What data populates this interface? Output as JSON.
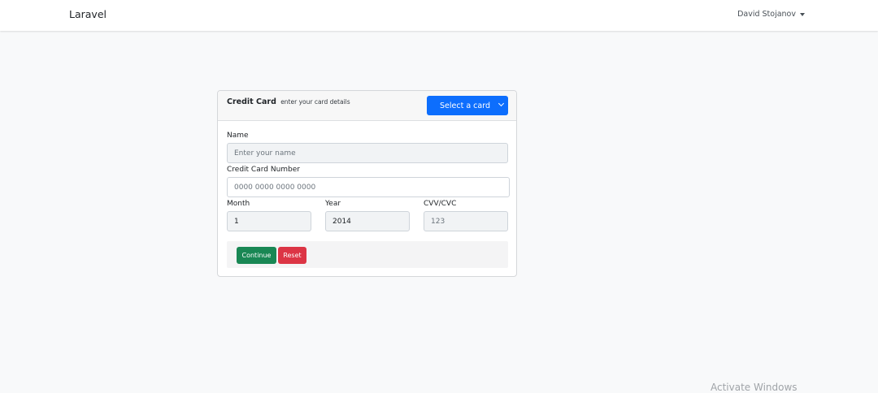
{
  "navbar": {
    "brand": "Laravel",
    "user_name": "David Stojanov"
  },
  "card": {
    "title": "Credit Card",
    "subtitle": "enter your card details",
    "select_label": "Select a card"
  },
  "form": {
    "name_label": "Name",
    "name_placeholder": "Enter your name",
    "card_number_label": "Credit Card Number",
    "card_number_placeholder": "0000 0000 0000 0000",
    "month_label": "Month",
    "month_value": "1",
    "year_label": "Year",
    "year_value": "2014",
    "cvv_label": "CVV/CVC",
    "cvv_placeholder": "123"
  },
  "buttons": {
    "continue": "Continue",
    "reset": "Reset"
  },
  "watermark": "Activate Windows",
  "colors": {
    "primary": "#0d6efd",
    "success": "#198754",
    "danger": "#dc3545",
    "background": "#f8f9fa"
  }
}
